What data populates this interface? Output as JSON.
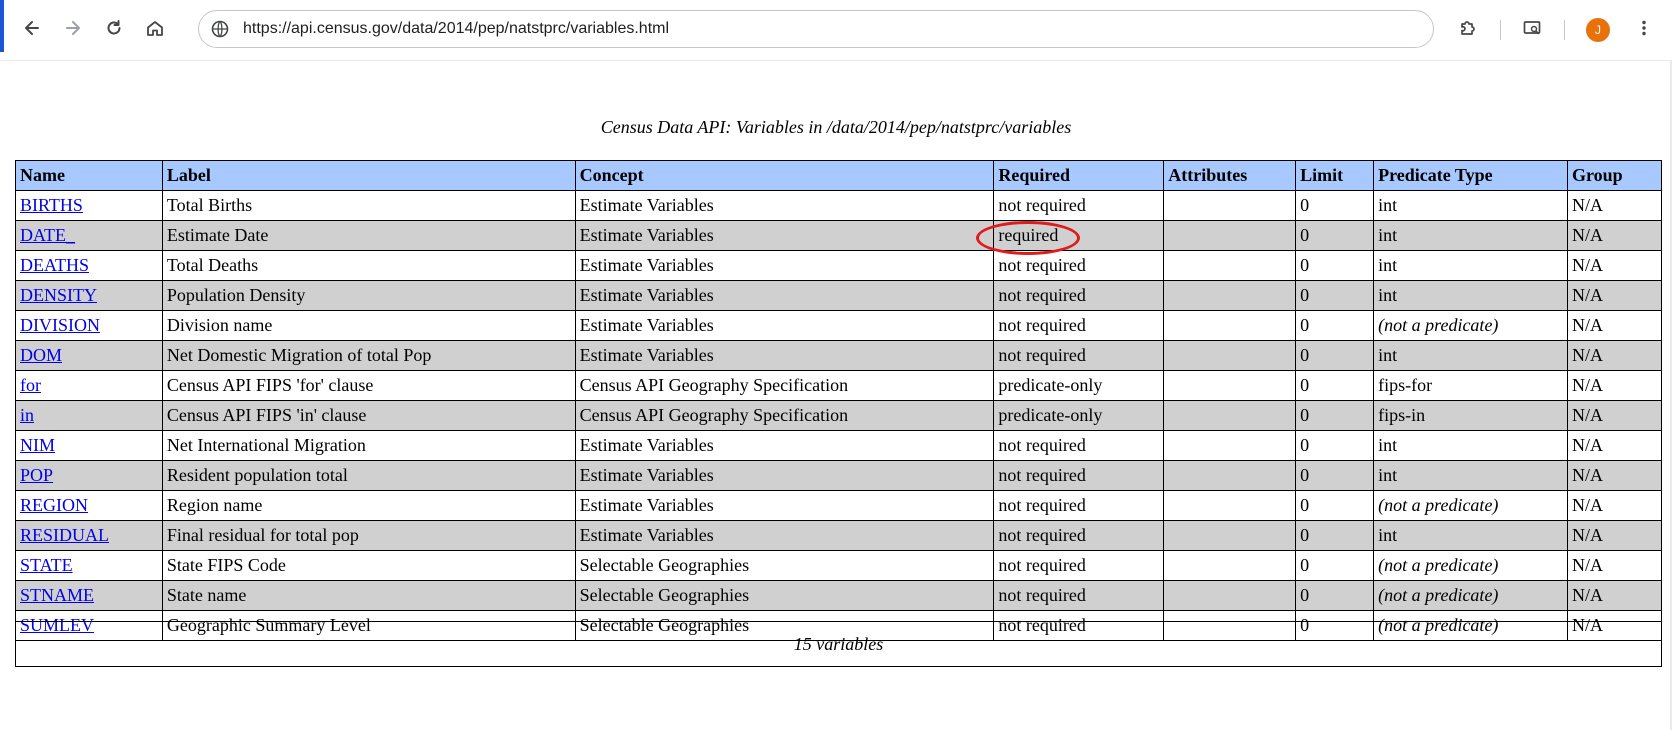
{
  "browser": {
    "url": "https://api.census.gov/data/2014/pep/natstprc/variables.html",
    "profile_initial": "J",
    "icons": {
      "back": "arrow-left-icon",
      "forward": "arrow-right-icon",
      "reload": "reload-icon",
      "home": "home-icon",
      "site_info": "site-info-icon",
      "extensions": "puzzle-icon",
      "screen": "screen-search-icon",
      "menu": "kebab-menu-icon"
    }
  },
  "page": {
    "caption": "Census Data API: Variables in /data/2014/pep/natstprc/variables",
    "headers": [
      "Name",
      "Label",
      "Concept",
      "Required",
      "Attributes",
      "Limit",
      "Predicate Type",
      "Group"
    ],
    "rows": [
      {
        "name": "BIRTHS",
        "label": "Total Births",
        "concept": "Estimate Variables",
        "required": "not required",
        "attributes": "",
        "limit": "0",
        "predicate_type": "int",
        "group": "N/A"
      },
      {
        "name": "DATE_",
        "label": "Estimate Date",
        "concept": "Estimate Variables",
        "required": "required",
        "attributes": "",
        "limit": "0",
        "predicate_type": "int",
        "group": "N/A"
      },
      {
        "name": "DEATHS",
        "label": "Total Deaths",
        "concept": "Estimate Variables",
        "required": "not required",
        "attributes": "",
        "limit": "0",
        "predicate_type": "int",
        "group": "N/A"
      },
      {
        "name": "DENSITY",
        "label": "Population Density",
        "concept": "Estimate Variables",
        "required": "not required",
        "attributes": "",
        "limit": "0",
        "predicate_type": "int",
        "group": "N/A"
      },
      {
        "name": "DIVISION",
        "label": "Division name",
        "concept": "Estimate Variables",
        "required": "not required",
        "attributes": "",
        "limit": "0",
        "predicate_type": "(not a predicate)",
        "group": "N/A"
      },
      {
        "name": "DOM",
        "label": "Net Domestic Migration of total Pop",
        "concept": "Estimate Variables",
        "required": "not required",
        "attributes": "",
        "limit": "0",
        "predicate_type": "int",
        "group": "N/A"
      },
      {
        "name": "for",
        "label": "Census API FIPS 'for' clause",
        "concept": "Census API Geography Specification",
        "required": "predicate-only",
        "attributes": "",
        "limit": "0",
        "predicate_type": "fips-for",
        "group": "N/A"
      },
      {
        "name": "in",
        "label": "Census API FIPS 'in' clause",
        "concept": "Census API Geography Specification",
        "required": "predicate-only",
        "attributes": "",
        "limit": "0",
        "predicate_type": "fips-in",
        "group": "N/A"
      },
      {
        "name": "NIM",
        "label": "Net International Migration",
        "concept": "Estimate Variables",
        "required": "not required",
        "attributes": "",
        "limit": "0",
        "predicate_type": "int",
        "group": "N/A"
      },
      {
        "name": "POP",
        "label": "Resident population total",
        "concept": "Estimate Variables",
        "required": "not required",
        "attributes": "",
        "limit": "0",
        "predicate_type": "int",
        "group": "N/A"
      },
      {
        "name": "REGION",
        "label": "Region name",
        "concept": "Estimate Variables",
        "required": "not required",
        "attributes": "",
        "limit": "0",
        "predicate_type": "(not a predicate)",
        "group": "N/A"
      },
      {
        "name": "RESIDUAL",
        "label": "Final residual for total pop",
        "concept": "Estimate Variables",
        "required": "not required",
        "attributes": "",
        "limit": "0",
        "predicate_type": "int",
        "group": "N/A"
      },
      {
        "name": "STATE",
        "label": "State FIPS Code",
        "concept": "Selectable Geographies",
        "required": "not required",
        "attributes": "",
        "limit": "0",
        "predicate_type": "(not a predicate)",
        "group": "N/A"
      },
      {
        "name": "STNAME",
        "label": "State name",
        "concept": "Selectable Geographies",
        "required": "not required",
        "attributes": "",
        "limit": "0",
        "predicate_type": "(not a predicate)",
        "group": "N/A"
      },
      {
        "name": "SUMLEV",
        "label": "Geographic Summary Level",
        "concept": "Selectable Geographies",
        "required": "not required",
        "attributes": "",
        "limit": "0",
        "predicate_type": "(not a predicate)",
        "group": "N/A"
      }
    ],
    "footer": "15 variables",
    "annotation_color": "#e01b1b"
  }
}
